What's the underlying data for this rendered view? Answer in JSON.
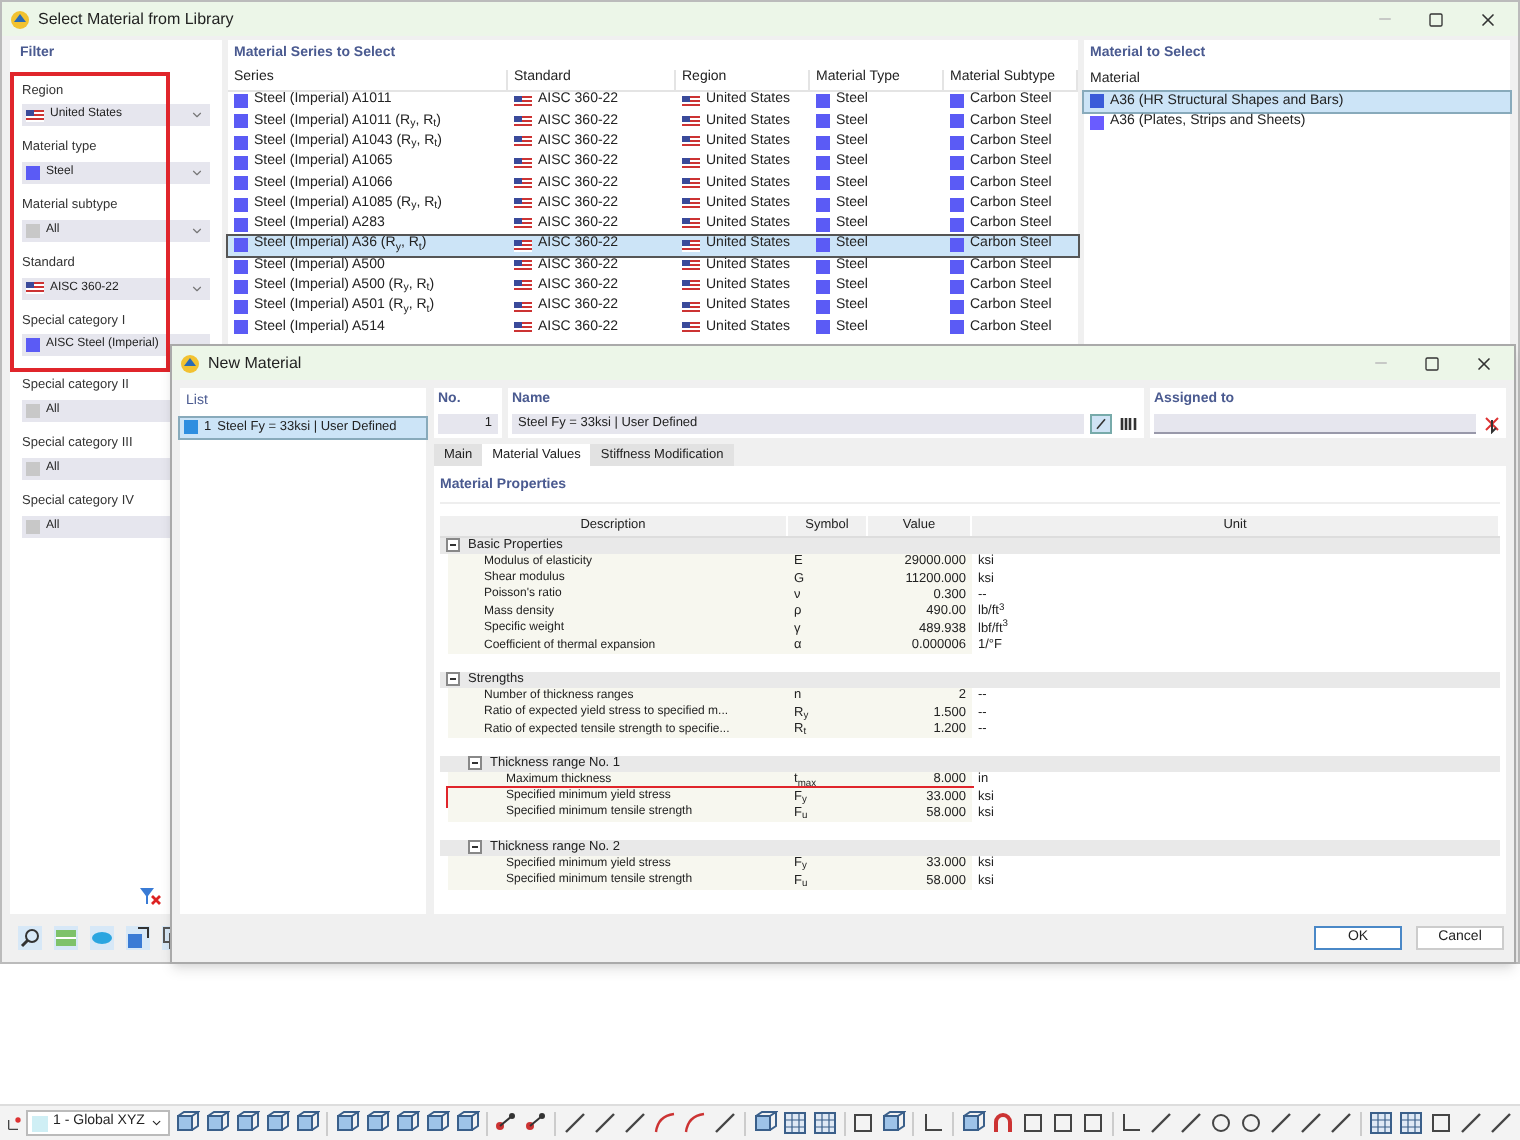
{
  "select_dialog": {
    "title": "Select Material from Library",
    "filter": {
      "title": "Filter",
      "marked_fields": [
        {
          "label": "Region",
          "value": "United States",
          "kind": "flag",
          "dropdown": true
        },
        {
          "label": "Material type",
          "value": "Steel",
          "kind": "swatch",
          "color": "#5b5bf5",
          "dropdown": true
        },
        {
          "label": "Material subtype",
          "value": "All",
          "kind": "swatch",
          "color": "#c8c8c8",
          "dropdown": true
        },
        {
          "label": "Standard",
          "value": "AISC 360-22",
          "kind": "flag",
          "dropdown": true
        },
        {
          "label": "Special category I",
          "value": "AISC Steel (Imperial)",
          "kind": "swatch",
          "color": "#5b5bf5",
          "dropdown": false
        }
      ],
      "fields": [
        {
          "label": "Special category II",
          "value": "All",
          "kind": "swatch",
          "color": "#c8c8c8"
        },
        {
          "label": "Special category III",
          "value": "All",
          "kind": "swatch",
          "color": "#c8c8c8"
        },
        {
          "label": "Special category IV",
          "value": "All",
          "kind": "swatch",
          "color": "#c8c8c8"
        }
      ]
    },
    "series": {
      "title": "Material Series to Select",
      "columns": [
        "Series",
        "Standard",
        "Region",
        "Material Type",
        "Material Subtype"
      ],
      "rows": [
        {
          "series": "Steel (Imperial) A1011",
          "standard": "AISC 360-22",
          "region": "United States",
          "type": "Steel",
          "subtype": "Carbon Steel",
          "selected": false
        },
        {
          "series": "Steel (Imperial) A1011 (R$_{y}$, R$_{t}$)",
          "standard": "AISC 360-22",
          "region": "United States",
          "type": "Steel",
          "subtype": "Carbon Steel",
          "selected": false
        },
        {
          "series": "Steel (Imperial) A1043 (R$_{y}$, R$_{t}$)",
          "standard": "AISC 360-22",
          "region": "United States",
          "type": "Steel",
          "subtype": "Carbon Steel",
          "selected": false
        },
        {
          "series": "Steel (Imperial) A1065",
          "standard": "AISC 360-22",
          "region": "United States",
          "type": "Steel",
          "subtype": "Carbon Steel",
          "selected": false
        },
        {
          "series": "Steel (Imperial) A1066",
          "standard": "AISC 360-22",
          "region": "United States",
          "type": "Steel",
          "subtype": "Carbon Steel",
          "selected": false
        },
        {
          "series": "Steel (Imperial) A1085 (R$_{y}$, R$_{t}$)",
          "standard": "AISC 360-22",
          "region": "United States",
          "type": "Steel",
          "subtype": "Carbon Steel",
          "selected": false
        },
        {
          "series": "Steel (Imperial) A283",
          "standard": "AISC 360-22",
          "region": "United States",
          "type": "Steel",
          "subtype": "Carbon Steel",
          "selected": false
        },
        {
          "series": "Steel (Imperial) A36 (R$_{y}$, R$_{t}$)",
          "standard": "AISC 360-22",
          "region": "United States",
          "type": "Steel",
          "subtype": "Carbon Steel",
          "selected": true
        },
        {
          "series": "Steel (Imperial) A500",
          "standard": "AISC 360-22",
          "region": "United States",
          "type": "Steel",
          "subtype": "Carbon Steel",
          "selected": false
        },
        {
          "series": "Steel (Imperial) A500 (R$_{y}$, R$_{t}$)",
          "standard": "AISC 360-22",
          "region": "United States",
          "type": "Steel",
          "subtype": "Carbon Steel",
          "selected": false
        },
        {
          "series": "Steel (Imperial) A501 (R$_{y}$, R$_{t}$)",
          "standard": "AISC 360-22",
          "region": "United States",
          "type": "Steel",
          "subtype": "Carbon Steel",
          "selected": false
        },
        {
          "series": "Steel (Imperial) A514",
          "standard": "AISC 360-22",
          "region": "United States",
          "type": "Steel",
          "subtype": "Carbon Steel",
          "selected": false
        }
      ]
    },
    "materials": {
      "title": "Material to Select",
      "column": "Material",
      "rows": [
        {
          "name": "A36 (HR Structural Shapes and Bars)",
          "selected": true,
          "color": "#3a5bd9"
        },
        {
          "name": "A36 (Plates, Strips and Sheets)",
          "selected": false,
          "color": "#6a5cff"
        }
      ]
    }
  },
  "new_material": {
    "title": "New Material",
    "list": {
      "title": "List",
      "items": [
        {
          "number": "1",
          "name": "Steel Fy = 33ksi | User Defined",
          "selected": true
        }
      ]
    },
    "number": {
      "label": "No.",
      "value": "1"
    },
    "name": {
      "label": "Name",
      "value": "Steel Fy = 33ksi | User Defined"
    },
    "assigned": {
      "label": "Assigned to"
    },
    "tabs": [
      {
        "label": "Main",
        "selected": false
      },
      {
        "label": "Material Values",
        "selected": true
      },
      {
        "label": "Stiffness Modification",
        "selected": false
      }
    ],
    "properties": {
      "title": "Material Properties",
      "columns": [
        "Description",
        "Symbol",
        "Value",
        "Unit"
      ],
      "groups": [
        {
          "label": "Basic Properties",
          "expanded": true,
          "rows": [
            {
              "description": "Modulus of elasticity",
              "symbol": "E",
              "value": "29000.000",
              "unit": "ksi"
            },
            {
              "description": "Shear modulus",
              "symbol": "G",
              "value": "11200.000",
              "unit": "ksi"
            },
            {
              "description": "Poisson's ratio",
              "symbol": "ν",
              "value": "0.300",
              "unit": "--"
            },
            {
              "description": "Mass density",
              "symbol": "ρ",
              "value": "490.00",
              "unit": "lb/ft$^{3}$"
            },
            {
              "description": "Specific weight",
              "symbol": "γ",
              "value": "489.938",
              "unit": "lbf/ft$^{3}$"
            },
            {
              "description": "Coefficient of thermal expansion",
              "symbol": "α",
              "value": "0.000006",
              "unit": "1/°F"
            }
          ]
        },
        {
          "label": "Strengths",
          "expanded": true,
          "rows": [
            {
              "description": "Number of thickness ranges",
              "symbol": "n",
              "value": "2",
              "unit": "--"
            },
            {
              "description": "Ratio of expected yield stress to specified m...",
              "symbol": "R$_{y}$",
              "value": "1.500",
              "unit": "--"
            },
            {
              "description": "Ratio of expected tensile strength to specifie...",
              "symbol": "R$_{t}$",
              "value": "1.200",
              "unit": "--"
            }
          ],
          "children": [
            {
              "label": "Thickness range No. 1",
              "expanded": true,
              "rows": [
                {
                  "description": "Maximum thickness",
                  "symbol": "t$_{max}$",
                  "value": "8.000",
                  "unit": "in"
                },
                {
                  "description": "Specified minimum yield stress",
                  "symbol": "F$_{y}$",
                  "value": "33.000",
                  "unit": "ksi",
                  "highlighted": true
                },
                {
                  "description": "Specified minimum tensile strength",
                  "symbol": "F$_{u}$",
                  "value": "58.000",
                  "unit": "ksi"
                }
              ]
            },
            {
              "label": "Thickness range No. 2",
              "expanded": true,
              "rows": [
                {
                  "description": "Specified minimum yield stress",
                  "symbol": "F$_{y}$",
                  "value": "33.000",
                  "unit": "ksi"
                },
                {
                  "description": "Specified minimum tensile strength",
                  "symbol": "F$_{u}$",
                  "value": "58.000",
                  "unit": "ksi"
                }
              ]
            }
          ]
        }
      ]
    },
    "buttons": [
      {
        "label": "OK",
        "default": true
      },
      {
        "label": "Cancel",
        "default": false
      }
    ]
  },
  "toolbar": {
    "coordinate_system": "1 - Global XYZ"
  }
}
